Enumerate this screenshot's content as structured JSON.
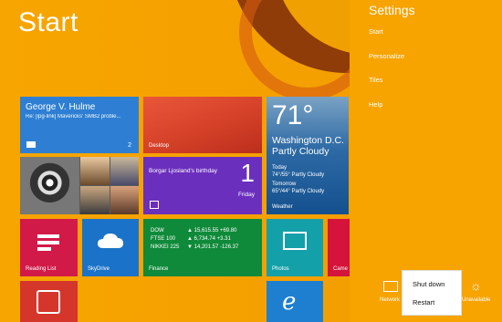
{
  "start_screen": {
    "title": "Start"
  },
  "tiles": {
    "mail": {
      "name": "George V. Hulme",
      "subject": "Re: [lpg-link] Mavericks' SMB2 proble...",
      "count": "2"
    },
    "desktop": {
      "label": "Desktop"
    },
    "calendar": {
      "event": "Borgar Ljosland's birthday",
      "day_num": "1",
      "day_name": "Friday"
    },
    "weather": {
      "temp": "71°",
      "location": "Washington D.C.",
      "condition": "Partly Cloudy",
      "today_label": "Today",
      "today_value": "74°/55° Partly Cloudy",
      "tomorrow_label": "Tomorrow",
      "tomorrow_value": "65°/44° Partly Cloudy",
      "label": "Weather"
    },
    "reading_list": {
      "label": "Reading List"
    },
    "skydrive": {
      "label": "SkyDrive"
    },
    "finance": {
      "label": "Finance",
      "rows": [
        {
          "name": "DOW",
          "value": "▲ 15,615.55 +69.80"
        },
        {
          "name": "FTSE 100",
          "value": "▲ 6,734.74 +3.31"
        },
        {
          "name": "NIKKEI 225",
          "value": "▼ 14,201.57 -126.37"
        }
      ]
    },
    "photos": {
      "label": "Photos"
    },
    "camera": {
      "label": "Came"
    },
    "ie": {
      "glyph": "e"
    }
  },
  "settings": {
    "title": "Settings",
    "items": [
      "Start",
      "Personalize",
      "Tiles",
      "Help"
    ],
    "network_label": "Network",
    "unavailable_label": "Unavailable",
    "unavailable_icon": "☼"
  },
  "power_menu": {
    "items": [
      "Shut down",
      "Restart"
    ]
  },
  "colors": {
    "background": "#f4a000",
    "mail": "#2e7fd3",
    "desktop": "#d23f27",
    "calendar": "#6b2fbd",
    "finance": "#0f8a3a",
    "reading_list": "#d11a48",
    "skydrive": "#1a73c8",
    "photos": "#14a0a8"
  }
}
